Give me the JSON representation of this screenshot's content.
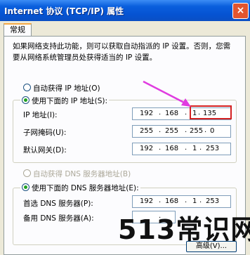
{
  "window": {
    "title": "Internet 协议 (TCP/IP) 属性",
    "close_label": "×"
  },
  "tab": {
    "label": "常规"
  },
  "description": "如果网络支持此功能，则可以获取自动指派的 IP 设置。否则，您需要从网络系统管理员处获得适当的 IP 设置。",
  "ip_section": {
    "auto_label": "自动获得 IP 地址(O)",
    "manual_label": "使用下面的 IP 地址(S):",
    "selected": "manual",
    "fields": [
      {
        "label": "IP 地址(I):",
        "octets": [
          "192",
          "168",
          "1",
          "135"
        ]
      },
      {
        "label": "子网掩码(U):",
        "octets": [
          "255",
          "255",
          "255",
          "0"
        ]
      },
      {
        "label": "默认网关(D):",
        "octets": [
          "192",
          "168",
          "1",
          "253"
        ]
      }
    ]
  },
  "dns_section": {
    "auto_label": "自动获得 DNS 服务器地址(B)",
    "manual_label": "使用下面的 DNS 服务器地址(E):",
    "selected": "manual",
    "fields": [
      {
        "label": "首选 DNS 服务器(P):",
        "octets": [
          "192",
          "168",
          "1",
          "253"
        ]
      },
      {
        "label": "备用 DNS 服务器(A):",
        "octets": [
          "",
          "",
          "",
          ""
        ]
      }
    ]
  },
  "advanced_button": "高级(V)...",
  "watermark": "513常识网",
  "colors": {
    "arrow": "#e03ce0",
    "highlight": "#d42020",
    "titlebar": "#0553d2"
  }
}
